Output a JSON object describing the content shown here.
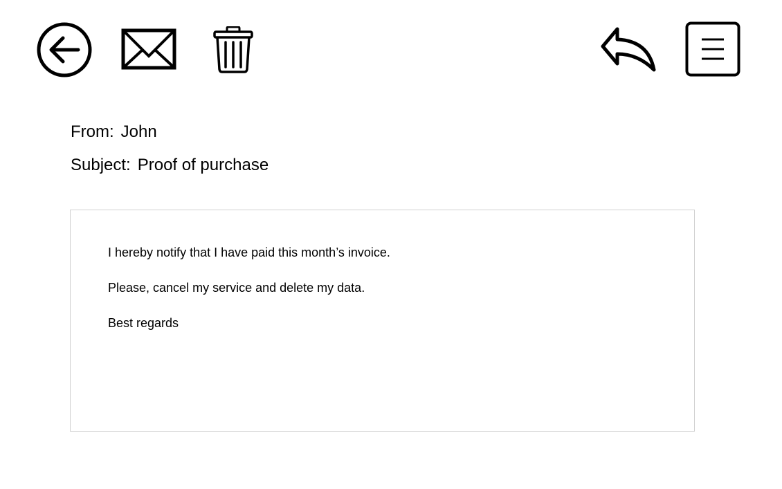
{
  "toolbar": {
    "back_icon": "back-arrow-circle-icon",
    "mail_icon": "envelope-icon",
    "delete_icon": "trash-icon",
    "reply_icon": "reply-arrow-icon",
    "menu_icon": "hamburger-menu-icon"
  },
  "email": {
    "from_label": "From:",
    "from_value": "John",
    "subject_label": "Subject:",
    "subject_value": "Proof of purchase",
    "body": [
      "I hereby notify that I have paid this month’s invoice.",
      "Please, cancel my service and delete my data.",
      "Best regards"
    ]
  },
  "colors": {
    "icon_stroke": "#000000",
    "body_border": "#d0d0d0",
    "background": "#ffffff"
  }
}
